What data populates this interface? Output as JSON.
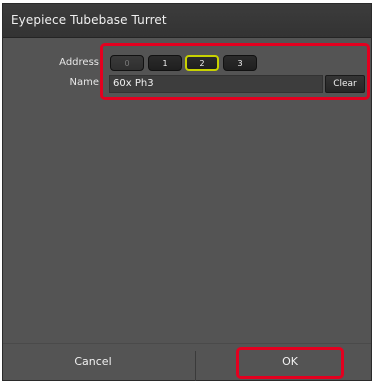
{
  "dialog": {
    "title": "Eyepiece Tubebase Turret"
  },
  "address": {
    "label": "Address",
    "buttons": [
      {
        "label": "0",
        "state": "disabled"
      },
      {
        "label": "1",
        "state": "normal"
      },
      {
        "label": "2",
        "state": "selected"
      },
      {
        "label": "3",
        "state": "normal"
      }
    ]
  },
  "name": {
    "label": "Name",
    "value": "60x Ph3",
    "clear_label": "Clear"
  },
  "footer": {
    "cancel_label": "Cancel",
    "ok_label": "OK"
  },
  "colors": {
    "dialog_bg": "#545454",
    "selected_outline": "#c8d200",
    "highlight_red": "#e3001f"
  }
}
